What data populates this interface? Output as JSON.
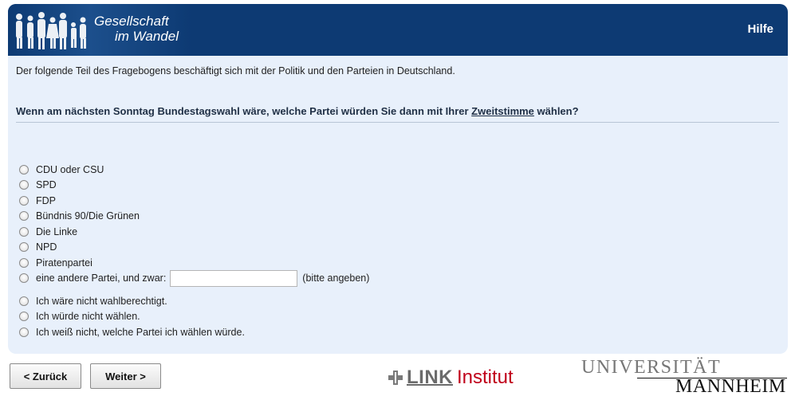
{
  "header": {
    "logo_line1": "Gesellschaft",
    "logo_line2": "im Wandel",
    "help_label": "Hilfe",
    "bg_color": "#0d3a73"
  },
  "content": {
    "bg_color": "#e8f0fb",
    "intro": "Der folgende Teil des Fragebogens beschäftigt sich mit der Politik und den Parteien in Deutschland.",
    "question_prefix": "Wenn am nächsten Sonntag Bundestagswahl wäre, welche Partei würden Sie dann mit Ihrer ",
    "question_emphasis": "Zweitstimme",
    "question_suffix": " wählen?",
    "options": [
      "CDU oder CSU",
      "SPD",
      "FDP",
      "Bündnis 90/Die Grünen",
      "Die Linke",
      "NPD",
      "Piratenpartei",
      "eine andere Partei, und zwar:"
    ],
    "other_input_value": "",
    "other_hint": "(bitte angeben)",
    "extra_options": [
      "Ich wäre nicht wahlberechtigt.",
      "Ich würde nicht wählen.",
      "Ich weiß nicht, welche Partei ich wählen würde."
    ]
  },
  "footer": {
    "back_label": "< Zurück",
    "next_label": "Weiter >",
    "link_word": "LINK",
    "institut_word": "Institut",
    "uni_top": "UNIVERSITÄT",
    "uni_bottom": "MANNHEIM",
    "institut_color": "#c0001a"
  }
}
